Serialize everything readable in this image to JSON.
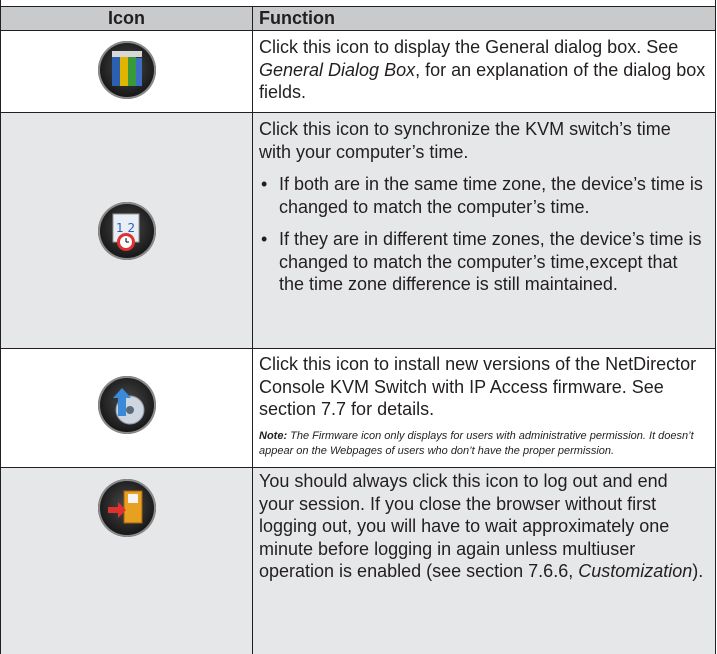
{
  "header": {
    "col_icon": "Icon",
    "col_function": "Function"
  },
  "rows": [
    {
      "icon": "general-icon",
      "text_pre": "Click this icon to display the General dialog box. See ",
      "text_link": "General Dialog Box",
      "text_post": ", for an explanation of the dialog box fields."
    },
    {
      "icon": "time-sync-icon",
      "intro": "Click this icon to synchronize the KVM switch’s time with your computer’s time.",
      "bullets": [
        "If both are in the same time zone, the device’s time is changed to match the computer’s time.",
        "If they are in different time zones, the device’s time is changed to match the computer’s time,except that the time zone difference is still maintained."
      ]
    },
    {
      "icon": "firmware-icon",
      "text": "Click this icon to install new versions of the NetDirector Console KVM Switch with IP Access firmware. See section 7.7 for details.",
      "note_label": "Note:",
      "note_text": " The Firmware icon only displays for users with administrative permission. It doesn’t appear on the Webpages of users who don’t have the proper permission."
    },
    {
      "icon": "logout-icon",
      "text_pre": "You should always click this icon to log out and end your session. If you close the browser without first logging out, you will have to wait approximately one minute before logging in again unless multiuser operation is enabled (see section 7.6.6, ",
      "text_link": "Customization",
      "text_post": ")."
    }
  ],
  "bullet_char": "•"
}
